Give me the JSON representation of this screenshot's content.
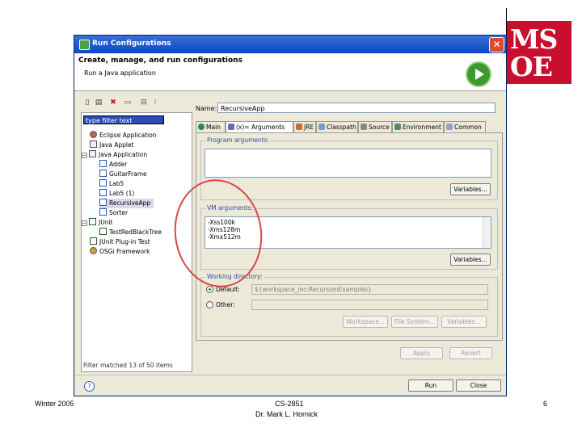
{
  "logo": {
    "line1": "MS",
    "line2": "OE",
    "color": "#c8102e"
  },
  "window": {
    "title": "Run Configurations",
    "header_title": "Create, manage, and run configurations",
    "header_subtitle": "Run a Java application"
  },
  "left": {
    "toolbar_icons": [
      "new-config-icon",
      "duplicate-icon",
      "delete-icon",
      "filter-icon",
      "collapse-all-icon",
      "more-menu-icon"
    ],
    "filter_placeholder": "type filter text",
    "tree": [
      {
        "label": "Eclipse Application",
        "level": 1,
        "icon": "eclipse-icon"
      },
      {
        "label": "Java Applet",
        "level": 1,
        "icon": "applet-icon"
      },
      {
        "label": "Java Application",
        "level": 1,
        "icon": "java-app-icon",
        "expanded": true
      },
      {
        "label": "Adder",
        "level": 2,
        "icon": "java-class-icon"
      },
      {
        "label": "GuitarFrame",
        "level": 2,
        "icon": "java-class-icon"
      },
      {
        "label": "Lab5",
        "level": 2,
        "icon": "java-class-icon"
      },
      {
        "label": "Lab5 (1)",
        "level": 2,
        "icon": "java-class-icon"
      },
      {
        "label": "RecursiveApp",
        "level": 2,
        "icon": "java-class-icon",
        "selected": true
      },
      {
        "label": "Sorter",
        "level": 2,
        "icon": "java-class-icon"
      },
      {
        "label": "JUnit",
        "level": 1,
        "icon": "junit-icon",
        "expanded": true
      },
      {
        "label": "TestRedBlackTree",
        "level": 2,
        "icon": "junit-test-icon"
      },
      {
        "label": "JUnit Plug-in Test",
        "level": 1,
        "icon": "junit-plugin-icon"
      },
      {
        "label": "OSGi Framework",
        "level": 1,
        "icon": "osgi-icon"
      }
    ],
    "filter_status": "Filter matched 13 of 50 items"
  },
  "right": {
    "name_label": "Name:",
    "name_value": "RecursiveApp",
    "tabs": [
      {
        "label": "Main",
        "icon": "main-tab-icon"
      },
      {
        "label": "(x)= Arguments",
        "icon": "arguments-tab-icon",
        "active": true
      },
      {
        "label": "JRE",
        "icon": "jre-tab-icon"
      },
      {
        "label": "Classpath",
        "icon": "classpath-tab-icon"
      },
      {
        "label": "Source",
        "icon": "source-tab-icon"
      },
      {
        "label": "Environment",
        "icon": "environment-tab-icon"
      },
      {
        "label": "Common",
        "icon": "common-tab-icon"
      }
    ],
    "program_args_label": "Program arguments:",
    "program_args_value": "",
    "variables_label": "Variables...",
    "vm_args_label": "VM arguments:",
    "vm_args_lines": [
      "-Xss100k",
      "-Xms128m",
      "-Xmx512m"
    ],
    "workdir_label": "Working directory:",
    "default_label": "Default:",
    "default_value": "${workspace_loc:RecursionExamples}",
    "other_label": "Other:",
    "workspace_btn": "Workspace...",
    "filesystem_btn": "File System...",
    "variables_btn": "Variables...",
    "apply_btn": "Apply",
    "revert_btn": "Revert"
  },
  "bottom": {
    "run_btn": "Run",
    "close_btn": "Close"
  },
  "footer": {
    "left": "Winter 2005",
    "center_line1": "CS-2851",
    "center_line2": "Dr. Mark L. Hornick",
    "page": "6"
  },
  "annotation_color": "#d84848"
}
